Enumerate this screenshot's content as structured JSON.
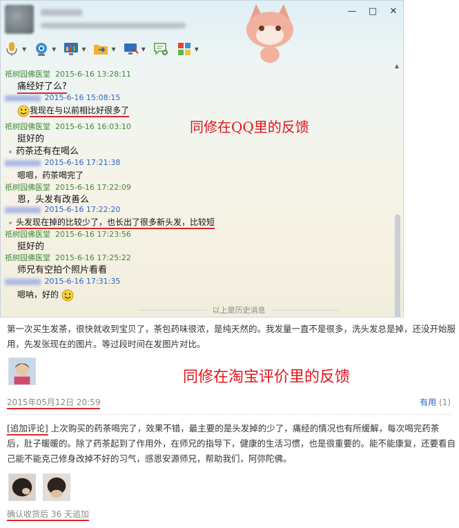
{
  "qq_window": {
    "window_controls": [
      "—",
      "□",
      "✕"
    ],
    "toolbar": [
      {
        "icon": "microphone-icon"
      },
      {
        "icon": "webcam-icon"
      },
      {
        "icon": "screen-share-icon"
      },
      {
        "icon": "file-transfer-icon"
      },
      {
        "icon": "remote-desktop-icon"
      },
      {
        "icon": "new-message-icon"
      },
      {
        "icon": "apps-icon"
      }
    ],
    "messages": [
      {
        "sender": "祇树园佛医堂",
        "time": "2015-6-16 13:28:11",
        "text": "痛经好了么?",
        "from_self": false
      },
      {
        "sender": "",
        "time": "2015-6-16 15:08:15",
        "text": "我现在与以前相比好很多了",
        "from_self": true
      },
      {
        "sender": "祇树园佛医堂",
        "time": "2015-6-16 16:03:10",
        "text": "挺好的",
        "text2": "药茶还有在喝么",
        "from_self": false
      },
      {
        "sender": "",
        "time": "2015-6-16 17:21:38",
        "text": "嗯嗯，药茶喝完了",
        "from_self": true
      },
      {
        "sender": "祇树园佛医堂",
        "time": "2015-6-16 17:22:09",
        "text": "恩，头发有改善么",
        "from_self": false
      },
      {
        "sender": "",
        "time": "2015-6-16 17:22:20",
        "text": "头发现在掉的比较少了，也长出了很多新头发，比较短",
        "from_self": true
      },
      {
        "sender": "祇树园佛医堂",
        "time": "2015-6-16 17:23:56",
        "text": "挺好的",
        "from_self": false
      },
      {
        "sender": "祇树园佛医堂",
        "time": "2015-6-16 17:25:22",
        "text": "师兄有空拍个照片看看",
        "from_self": false
      },
      {
        "sender": "",
        "time": "2015-6-16 17:31:35",
        "text": "嗯呐，好的",
        "from_self": true
      }
    ],
    "history_label": "以上是历史消息"
  },
  "annotations": {
    "qq_note": "同修在QQ里的反馈",
    "taobao_note": "同修在淘宝评价里的反馈"
  },
  "review": {
    "text": "第一次买生发茶，很快就收到宝贝了，茶包药味很浓，是纯天然的。我发量一直不是很多，洗头发总是掉，还没开始服用，先发张现在的图片。等过段时间在发图片对比。",
    "date": "2015年05月12日 20:59",
    "useful_label": "有用",
    "useful_count": "(1)",
    "additional_tag": "[追加评论]",
    "additional_text": "上次购买的药茶喝完了，效果不错，最主要的是头发掉的少了，痛经的情况也有所缓解，每次喝完药茶后，肚子暖暖的。除了药茶起到了作用外，在师兄的指导下，健康的生活习惯，也是很重要的。能不能康复，还要看自己能不能克己修身改掉不好的习气，感恩安源师兄，帮助我们，阿弥陀佛。",
    "confirm_note": "确认收货后 36 天追加"
  },
  "colors": {
    "annotation_red": "#e0141c",
    "underline_red": "#d8262b",
    "sender_green": "#3a8a36",
    "self_blue": "#2b62c6"
  }
}
